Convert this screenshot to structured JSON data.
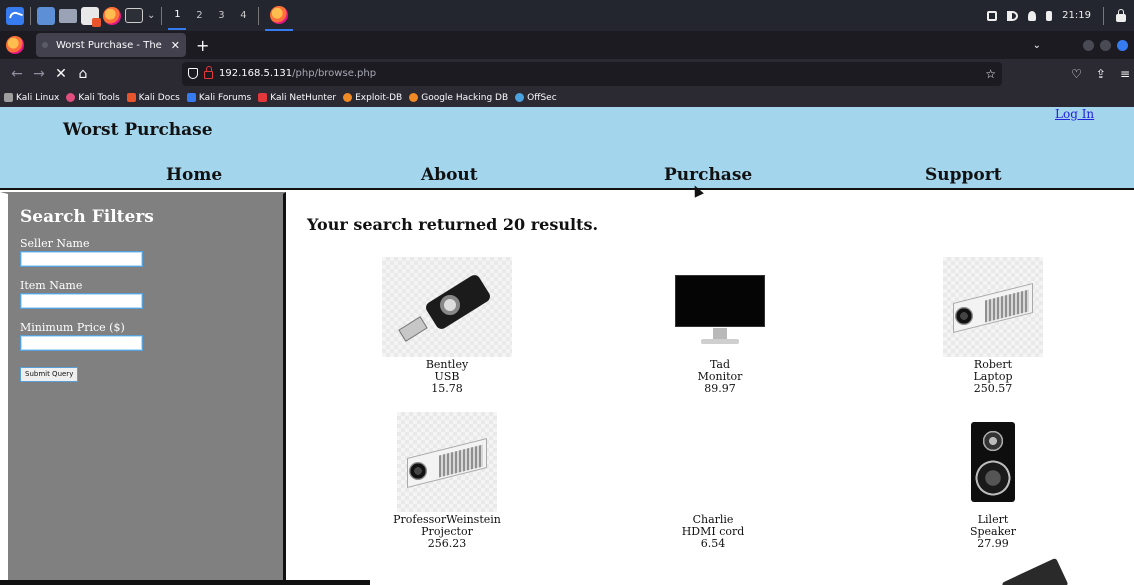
{
  "taskbar": {
    "workspaces": [
      "1",
      "2",
      "3",
      "4"
    ],
    "clock": "21:19"
  },
  "browser": {
    "tab_title": "Worst Purchase - The Wo",
    "url_host": "192.168.5.131",
    "url_path": "/php/browse.php",
    "bookmarks": [
      {
        "label": "Kali Linux",
        "color": "#9e9e9e"
      },
      {
        "label": "Kali Tools",
        "color": "#e04f7d"
      },
      {
        "label": "Kali Docs",
        "color": "#e8542b"
      },
      {
        "label": "Kali Forums",
        "color": "#367bf0"
      },
      {
        "label": "Kali NetHunter",
        "color": "#e2383b"
      },
      {
        "label": "Exploit-DB",
        "color": "#f08a24"
      },
      {
        "label": "Google Hacking DB",
        "color": "#f08a24"
      },
      {
        "label": "OffSec",
        "color": "#4aa3df"
      }
    ]
  },
  "site": {
    "title": "Worst Purchase",
    "login": "Log In",
    "menu": [
      "Home",
      "About",
      "Purchase",
      "Support"
    ],
    "header_bg": "#a3d5ec",
    "sidebar": {
      "title": "Search Filters",
      "seller_label": "Seller Name",
      "item_label": "Item Name",
      "price_label": "Minimum Price ($)",
      "submit_label": "Submit Query"
    },
    "results_title": "Your search returned 20 results.",
    "products": [
      {
        "seller": "Bentley",
        "item": "USB",
        "price": "15.78",
        "icon": "usb-drive-image"
      },
      {
        "seller": "Tad",
        "item": "Monitor",
        "price": "89.97",
        "icon": "monitor-image"
      },
      {
        "seller": "Robert",
        "item": "Laptop",
        "price": "250.57",
        "icon": "projector-image"
      },
      {
        "seller": "ProfessorWeinstein",
        "item": "Projector",
        "price": "256.23",
        "icon": "projector-image"
      },
      {
        "seller": "Charlie",
        "item": "HDMI cord",
        "price": "6.54",
        "icon": "none"
      },
      {
        "seller": "Lilert",
        "item": "Speaker",
        "price": "27.99",
        "icon": "speaker-image"
      }
    ]
  }
}
